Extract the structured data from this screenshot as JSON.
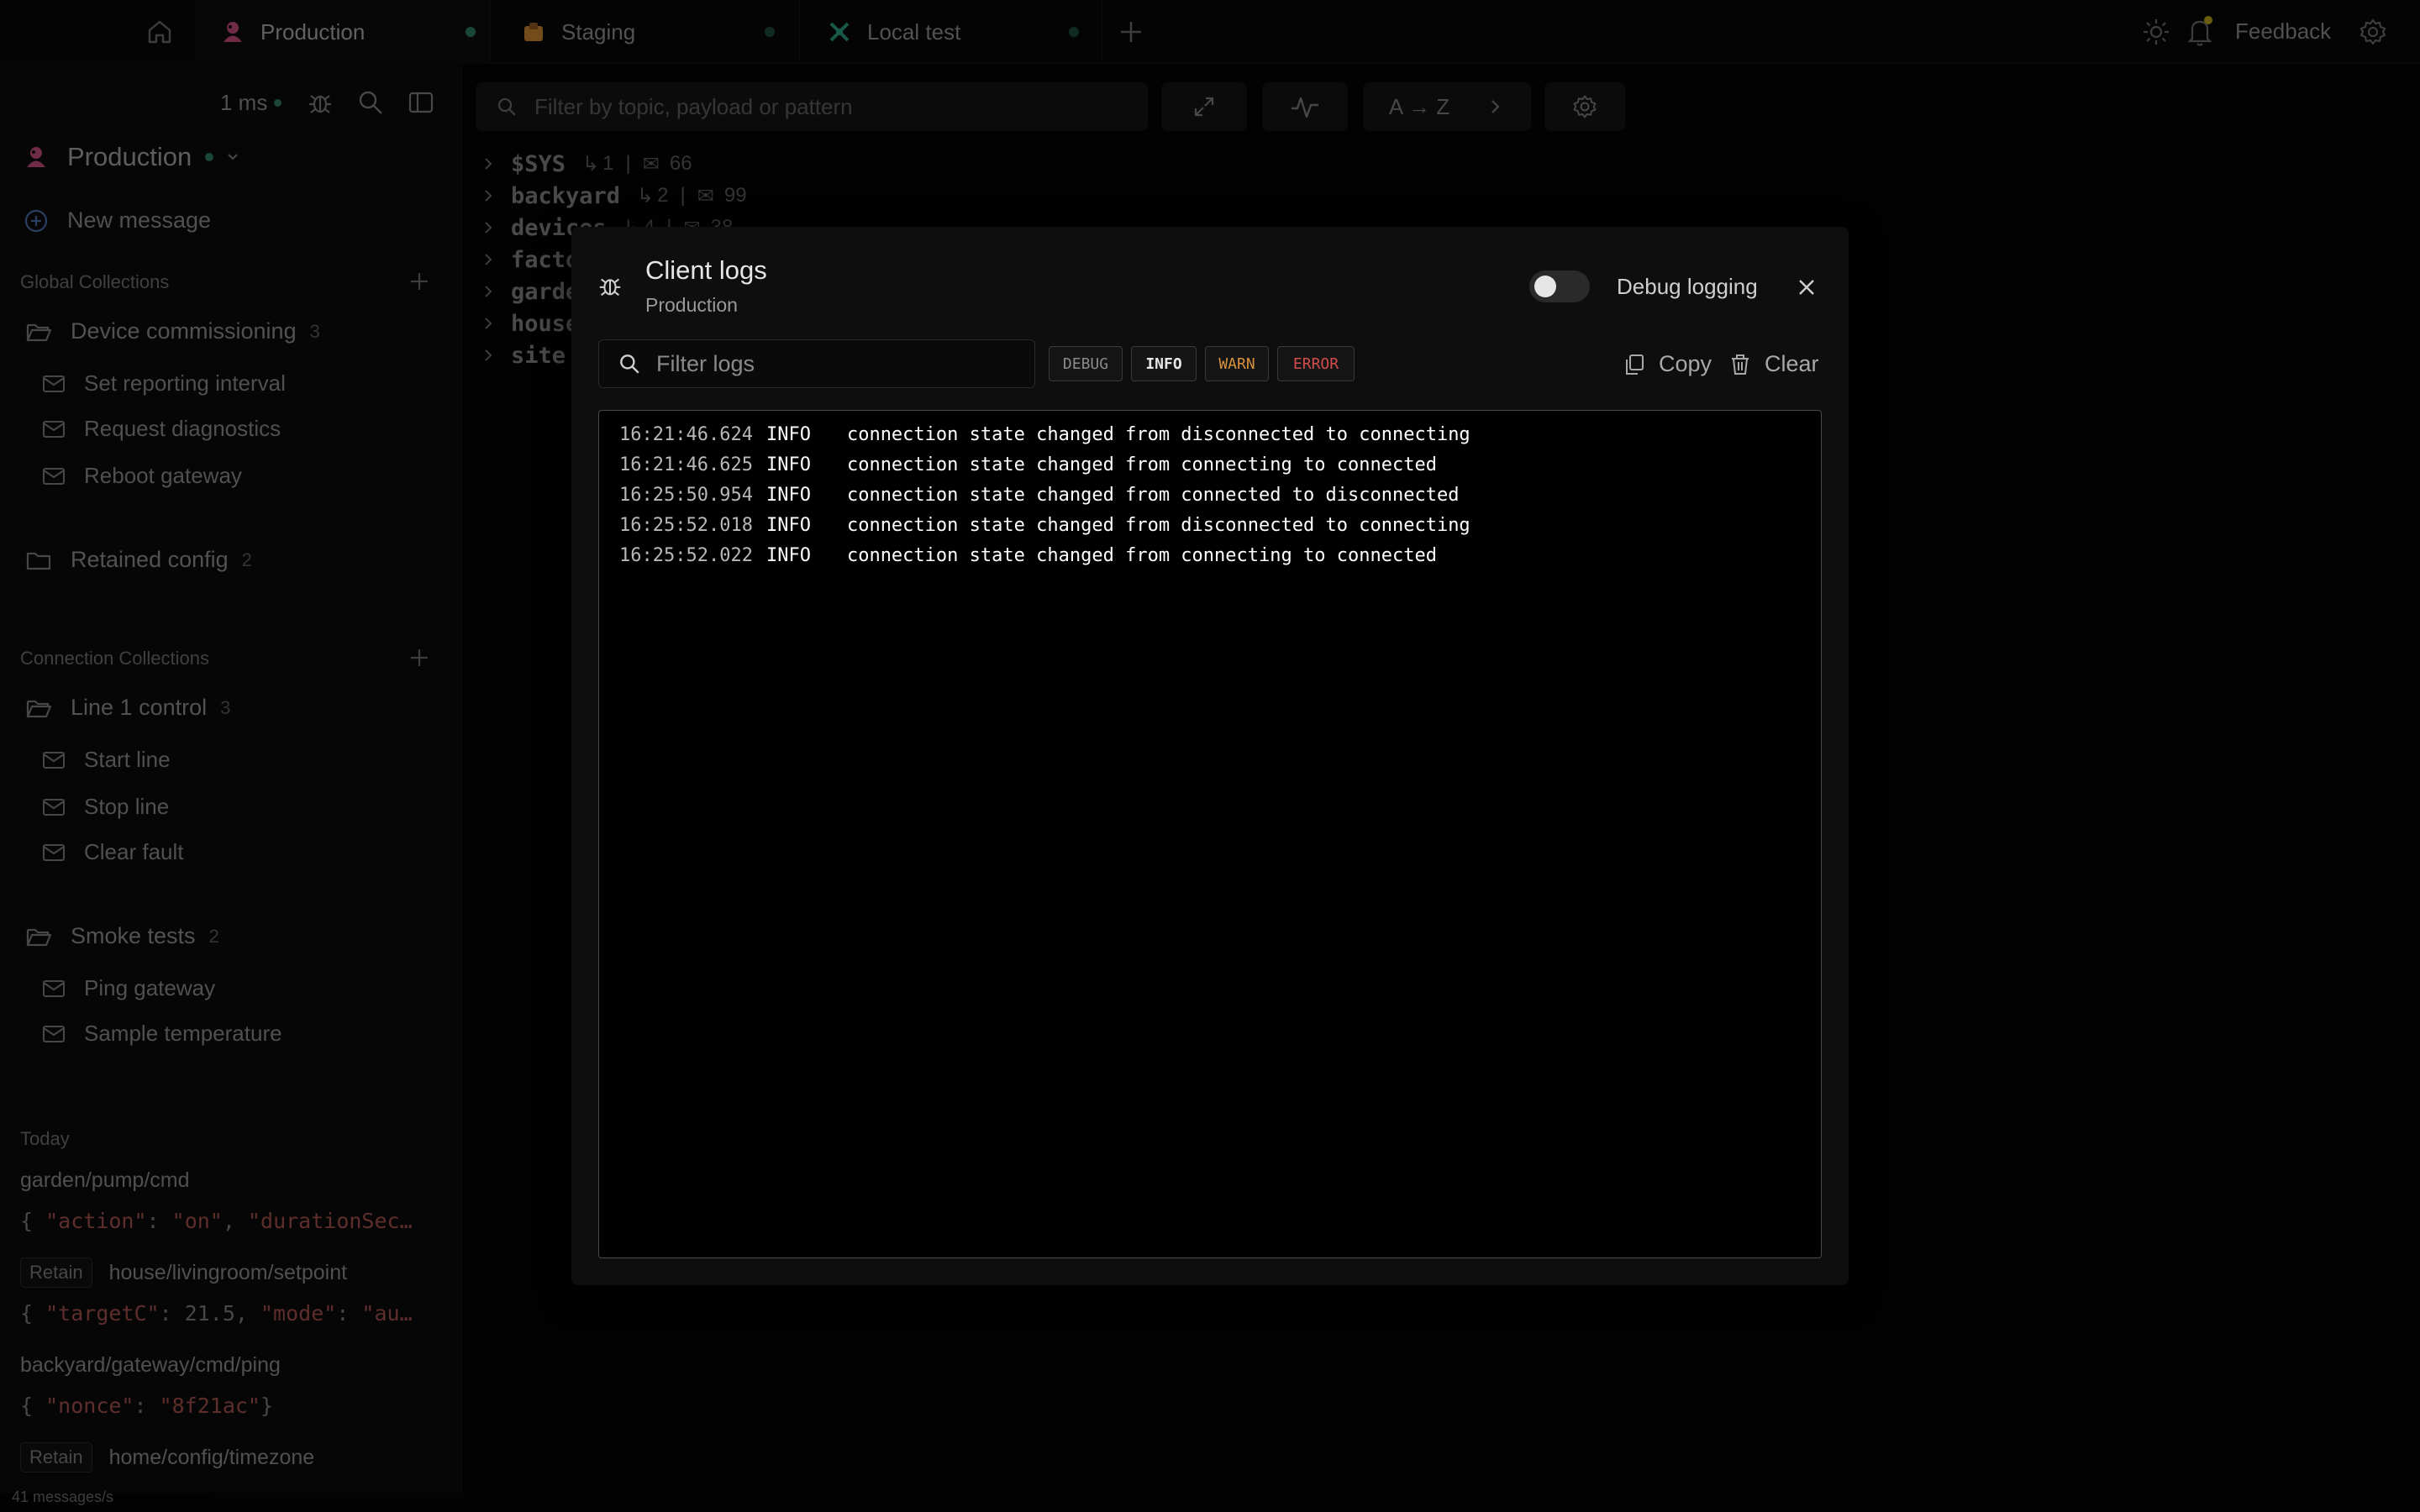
{
  "tabs": [
    {
      "label": "Production",
      "dot": "#2d7a60",
      "active": true
    },
    {
      "label": "Staging",
      "dot": "#2d7a60"
    },
    {
      "label": "Local test",
      "dot": "#2d7a60"
    }
  ],
  "topbar": {
    "feedback_label": "Feedback"
  },
  "sidebar": {
    "latency": "1 ms",
    "connection_name": "Production",
    "new_message_label": "New message",
    "global_collections_label": "Global Collections",
    "connection_collections_label": "Connection Collections",
    "global_folders": [
      {
        "name": "Device commissioning",
        "count": "3",
        "items": [
          "Set reporting interval",
          "Request diagnostics",
          "Reboot gateway"
        ]
      },
      {
        "name": "Retained config",
        "count": "2",
        "items": []
      }
    ],
    "connection_folders": [
      {
        "name": "Line 1 control",
        "count": "3",
        "items": [
          "Start line",
          "Stop line",
          "Clear fault"
        ]
      },
      {
        "name": "Smoke tests",
        "count": "2",
        "items": [
          "Ping gateway",
          "Sample temperature"
        ]
      }
    ],
    "today_label": "Today",
    "history": [
      {
        "topic": "garden/pump/cmd",
        "retain": false,
        "payload": "{ \"action\": \"on\", \"durationSec"
      },
      {
        "topic": "house/livingroom/setpoint",
        "retain": true,
        "payload": "{ \"targetC\": 21.5, \"mode\": \"au"
      },
      {
        "topic": "backyard/gateway/cmd/ping",
        "retain": false,
        "payload": "{ \"nonce\": \"8f21ac\"}"
      },
      {
        "topic": "home/config/timezone",
        "retain": true,
        "payload": ""
      }
    ],
    "retain_label": "Retain",
    "status": "41 messages/s"
  },
  "main": {
    "filter_placeholder": "Filter by topic, payload or pattern",
    "sort_label": "A → Z",
    "tree": [
      {
        "name": "$SYS",
        "sub": "1",
        "msgs": "66"
      },
      {
        "name": "backyard",
        "sub": "2",
        "msgs": "99"
      },
      {
        "name": "devices",
        "sub": "4",
        "msgs": "38"
      },
      {
        "name": "factory",
        "sub": "",
        "msgs": ""
      },
      {
        "name": "garden",
        "sub": "",
        "msgs": ""
      },
      {
        "name": "house",
        "sub": "",
        "msgs": ""
      },
      {
        "name": "site",
        "sub": "",
        "msgs": ""
      }
    ]
  },
  "modal": {
    "title": "Client logs",
    "subtitle": "Production",
    "debug_logging_label": "Debug logging",
    "debug_logging_on": false,
    "filter_placeholder": "Filter logs",
    "levels": [
      "DEBUG",
      "INFO",
      "WARN",
      "ERROR"
    ],
    "copy_label": "Copy",
    "clear_label": "Clear",
    "logs": [
      {
        "time": "16:21:46.624",
        "level": "INFO",
        "text": "connection state changed from disconnected to connecting"
      },
      {
        "time": "16:21:46.625",
        "level": "INFO",
        "text": "connection state changed from connecting to connected"
      },
      {
        "time": "16:25:50.954",
        "level": "INFO",
        "text": "connection state changed from connected to disconnected"
      },
      {
        "time": "16:25:52.018",
        "level": "INFO",
        "text": "connection state changed from disconnected to connecting"
      },
      {
        "time": "16:25:52.022",
        "level": "INFO",
        "text": "connection state changed from connecting to connected"
      }
    ]
  },
  "colors": {
    "accent_connected": "#2d7a60",
    "warn": "#d7923b",
    "error": "#d14c4c",
    "payload_string": "#a2504c"
  }
}
